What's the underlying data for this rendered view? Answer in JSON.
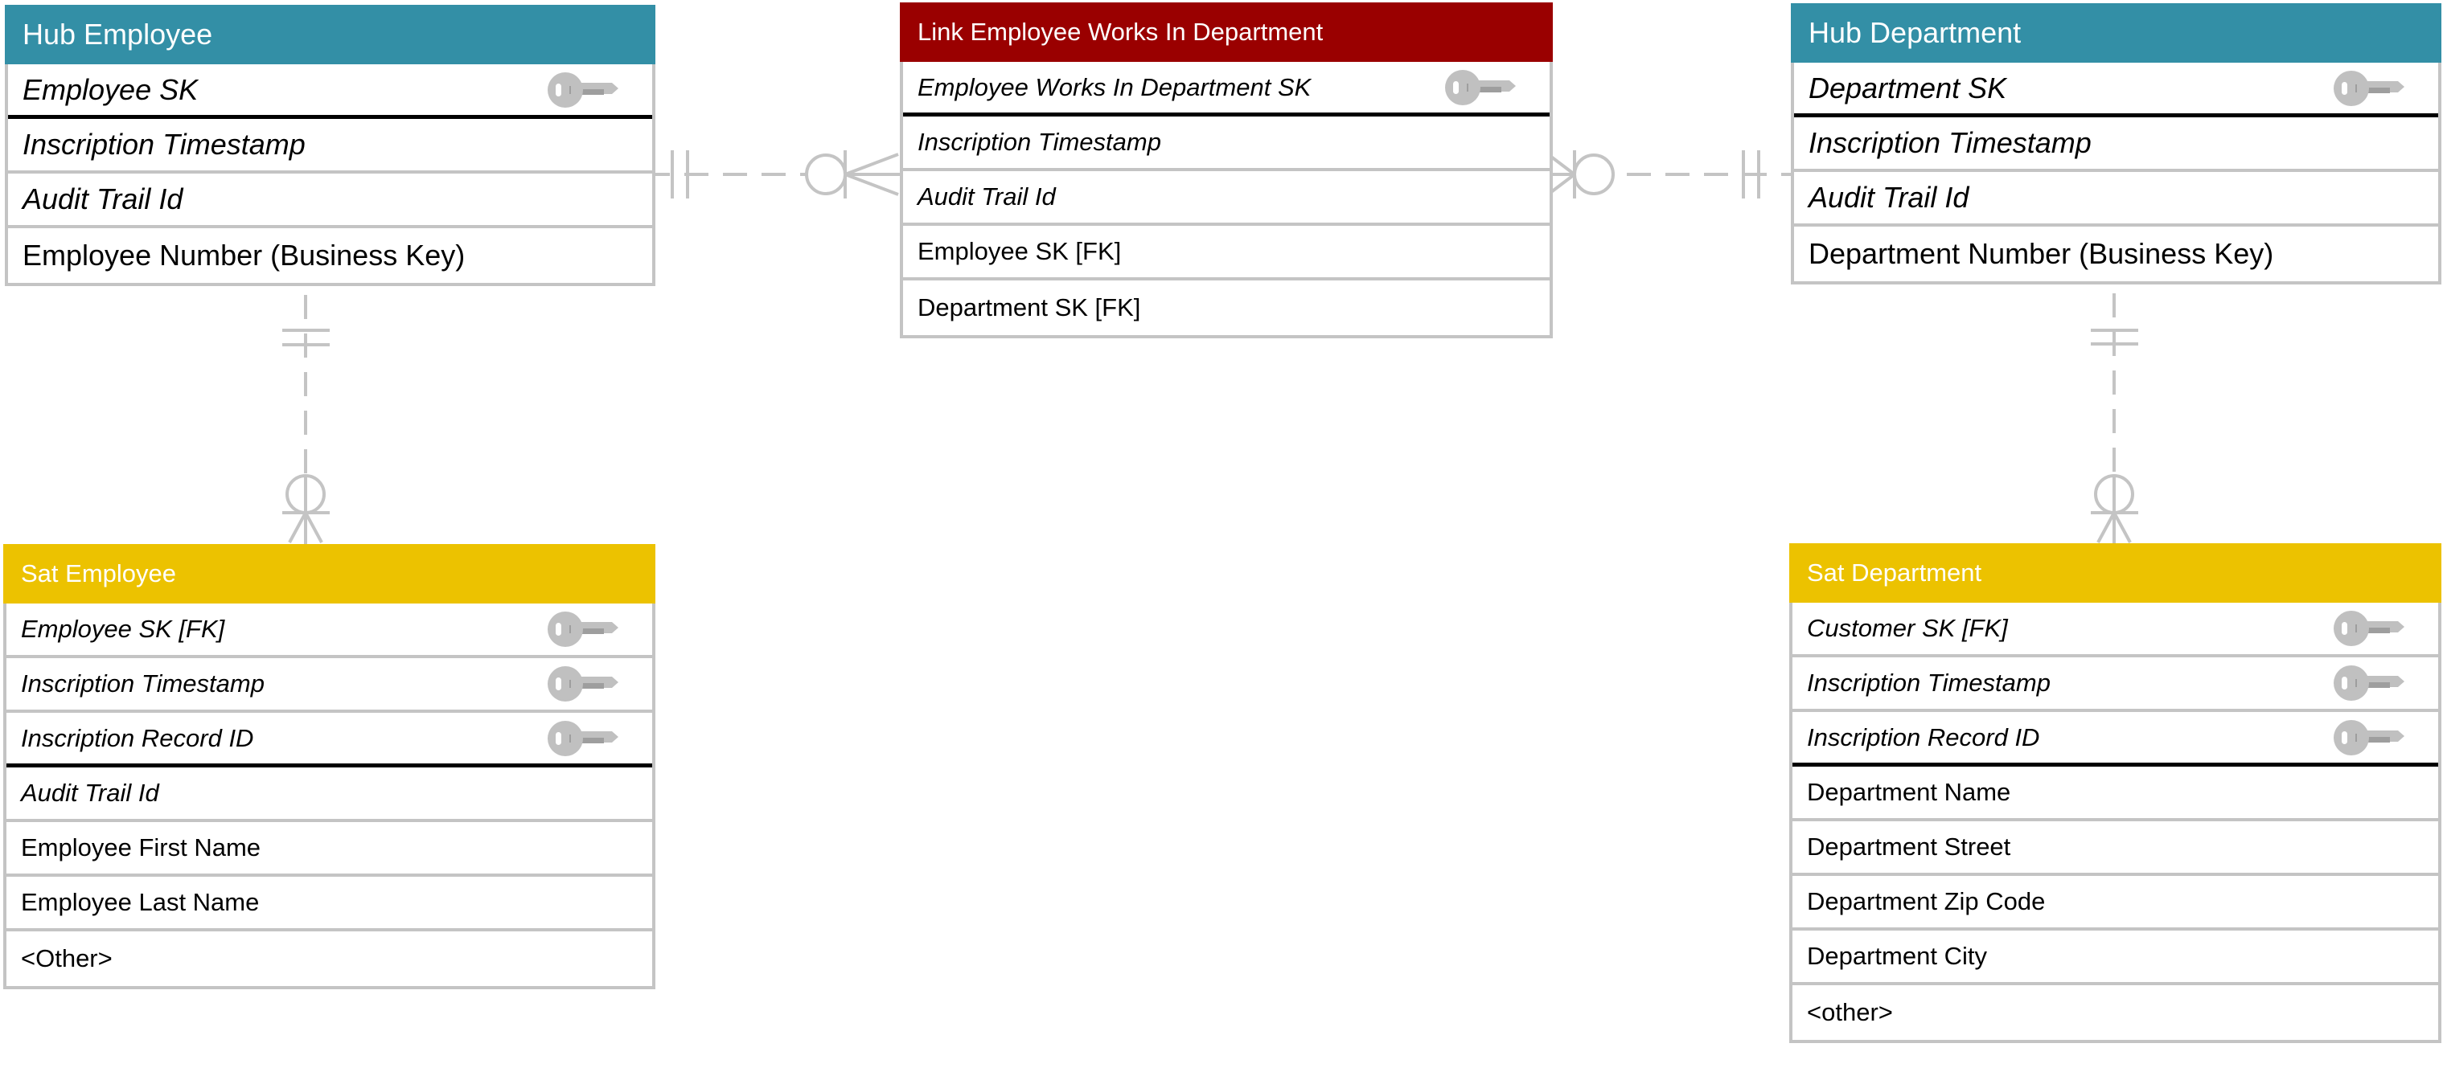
{
  "diagram": {
    "entities": {
      "hub_employee": {
        "title": "Hub Employee",
        "kind": "hub",
        "header_color": "#338fa6",
        "rows": [
          {
            "label": "Employee SK",
            "italic": true,
            "key": true,
            "pk_separator": true
          },
          {
            "label": "Inscription Timestamp",
            "italic": true,
            "key": false
          },
          {
            "label": "Audit Trail Id",
            "italic": true,
            "key": false
          },
          {
            "label": "Employee Number (Business Key)",
            "italic": false,
            "key": false
          }
        ]
      },
      "link_employee_works_in_department": {
        "title": "Link Employee Works In Department",
        "kind": "link",
        "header_color": "#9a0000",
        "rows": [
          {
            "label": "Employee Works In Department SK",
            "italic": true,
            "key": true,
            "pk_separator": true
          },
          {
            "label": "Inscription Timestamp",
            "italic": true,
            "key": false
          },
          {
            "label": "Audit Trail Id",
            "italic": true,
            "key": false
          },
          {
            "label": "Employee SK [FK]",
            "italic": false,
            "key": false
          },
          {
            "label": "Department SK [FK]",
            "italic": false,
            "key": false
          }
        ]
      },
      "hub_department": {
        "title": "Hub Department",
        "kind": "hub",
        "header_color": "#338fa6",
        "rows": [
          {
            "label": "Department SK",
            "italic": true,
            "key": true,
            "pk_separator": true
          },
          {
            "label": "Inscription Timestamp",
            "italic": true,
            "key": false
          },
          {
            "label": "Audit Trail Id",
            "italic": true,
            "key": false
          },
          {
            "label": "Department Number (Business Key)",
            "italic": false,
            "key": false
          }
        ]
      },
      "sat_employee": {
        "title": "Sat Employee",
        "kind": "satellite",
        "header_color": "#ecc200",
        "rows": [
          {
            "label": "Employee SK [FK]",
            "italic": true,
            "key": true
          },
          {
            "label": "Inscription Timestamp",
            "italic": true,
            "key": true
          },
          {
            "label": "Inscription Record ID",
            "italic": true,
            "key": true,
            "pk_separator": true
          },
          {
            "label": "Audit Trail Id",
            "italic": true,
            "key": false
          },
          {
            "label": "Employee First Name",
            "italic": false,
            "key": false
          },
          {
            "label": "Employee Last Name",
            "italic": false,
            "key": false
          },
          {
            "label": "<Other>",
            "italic": false,
            "key": false
          }
        ]
      },
      "sat_department": {
        "title": "Sat Department",
        "kind": "satellite",
        "header_color": "#ecc200",
        "rows": [
          {
            "label": "Customer SK [FK]",
            "italic": true,
            "key": true
          },
          {
            "label": "Inscription Timestamp",
            "italic": true,
            "key": true
          },
          {
            "label": "Inscription Record ID",
            "italic": true,
            "key": true,
            "pk_separator": true
          },
          {
            "label": "Department Name",
            "italic": false,
            "key": false
          },
          {
            "label": "Department Street",
            "italic": false,
            "key": false
          },
          {
            "label": "Department Zip Code",
            "italic": false,
            "key": false
          },
          {
            "label": "Department City",
            "italic": false,
            "key": false
          },
          {
            "label": "<other>",
            "italic": false,
            "key": false
          }
        ]
      }
    },
    "relationships": [
      {
        "from": "hub_employee",
        "to": "link_employee_works_in_department",
        "from_cardinality": "exactly-one",
        "to_cardinality": "zero-or-many",
        "style": "dashed"
      },
      {
        "from": "hub_department",
        "to": "link_employee_works_in_department",
        "from_cardinality": "exactly-one",
        "to_cardinality": "zero-or-many",
        "style": "dashed"
      },
      {
        "from": "hub_employee",
        "to": "sat_employee",
        "from_cardinality": "exactly-one",
        "to_cardinality": "zero-or-many",
        "style": "dashed"
      },
      {
        "from": "hub_department",
        "to": "sat_department",
        "from_cardinality": "exactly-one",
        "to_cardinality": "zero-or-many",
        "style": "dashed"
      }
    ],
    "colors": {
      "hub": "#338fa6",
      "link": "#9a0000",
      "satellite": "#ecc200",
      "border": "#c4c4c4",
      "connector": "#c4c4c4",
      "key_icon": "#c0c0c0"
    }
  }
}
